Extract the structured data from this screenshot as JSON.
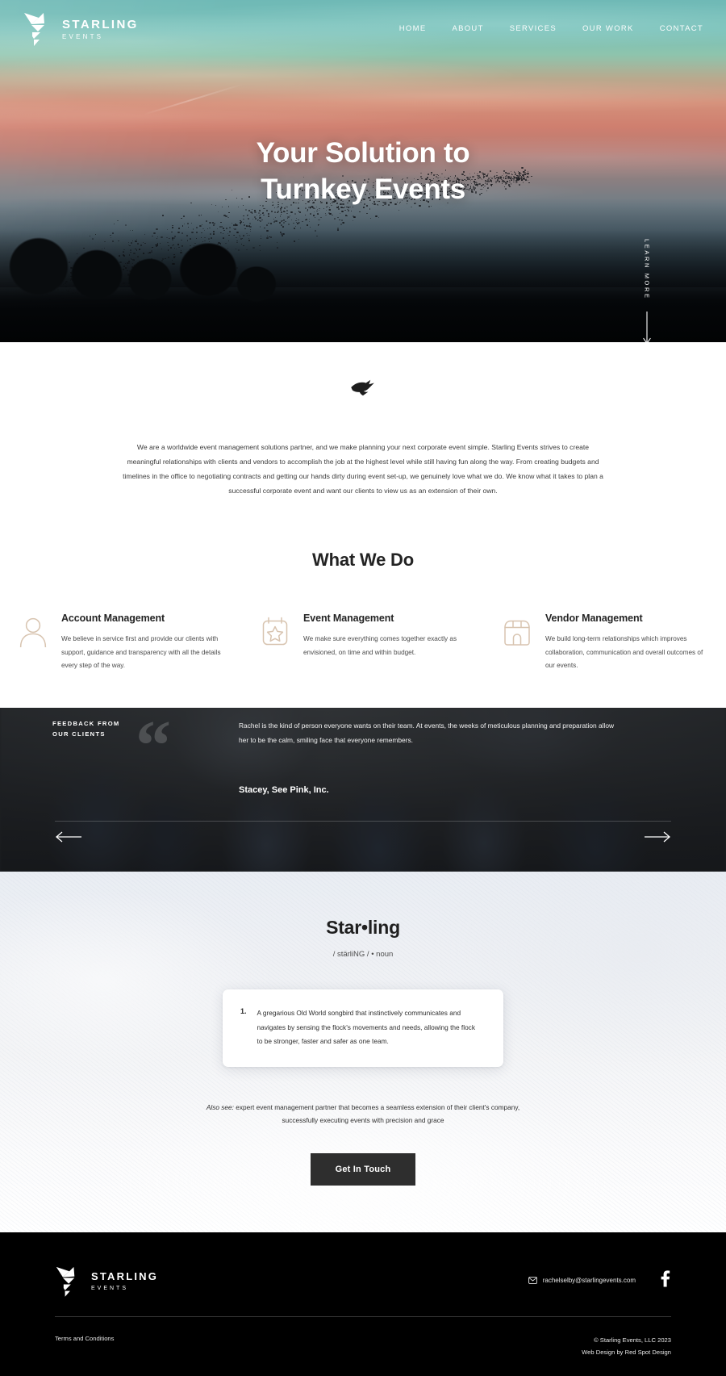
{
  "brand": {
    "name": "STARLING",
    "sub": "EVENTS"
  },
  "nav": {
    "items": [
      {
        "label": "HOME"
      },
      {
        "label": "ABOUT"
      },
      {
        "label": "SERVICES"
      },
      {
        "label": "OUR WORK"
      },
      {
        "label": "CONTACT"
      }
    ]
  },
  "hero": {
    "title_line1": "Your Solution to",
    "title_line2": "Turnkey Events",
    "learn_more": "LEARN MORE"
  },
  "intro": {
    "paragraph": "We are a worldwide event management solutions partner, and we make planning your next corporate event simple. Starling Events strives to create meaningful relationships with clients and vendors to accomplish the job at the highest level while still having fun along the way. From creating budgets and timelines in the office to negotiating contracts and getting our hands dirty during event set-up, we genuinely love what we do. We know what it takes to plan a successful corporate event and want our clients to view us as an extension of their own."
  },
  "what_we_do": {
    "title": "What We Do",
    "cards": [
      {
        "icon": "person-icon",
        "heading": "Account Management",
        "text": "We believe in service first and provide our clients with support, guidance and transparency with all the details every step of the way."
      },
      {
        "icon": "calendar-star-icon",
        "heading": "Event Management",
        "text": "We make sure everything comes together exactly as envisioned, on time and within budget."
      },
      {
        "icon": "storefront-icon",
        "heading": "Vendor Management",
        "text": "We build long-term relationships which improves collaboration, communication and overall outcomes of our events."
      }
    ]
  },
  "testimonial": {
    "label_line1": "FEEDBACK FROM",
    "label_line2": "OUR CLIENTS",
    "quote_mark": "“",
    "quote": "Rachel is the kind of person everyone wants on their team. At events, the weeks of meticulous planning and preparation allow her to be the calm, smiling face that everyone remembers.",
    "author": "Stacey, See Pink, Inc.",
    "prev": "previous-testimonial",
    "next": "next-testimonial"
  },
  "definition": {
    "word": "Star•ling",
    "pronunciation": "/ stärliNG / • noun",
    "entry_number": "1.",
    "entry_text": "A gregarious Old World songbird that instinctively communicates and navigates by sensing the flock's movements and needs, allowing the flock to be stronger, faster and safer as one team.",
    "also_see_label": "Also see:",
    "also_see_text": " expert event management partner that becomes a seamless extension of their client's company, successfully executing events with precision and grace",
    "cta": "Get In Touch"
  },
  "footer": {
    "email": "rachelselby@starlingevents.com",
    "terms": "Terms and Conditions",
    "copyright": "© Starling Events, LLC 2023",
    "credit": "Web Design by Red Spot Design",
    "social": "facebook-icon"
  },
  "colors": {
    "accent_tan": "#d8c4b0",
    "dark": "#2e2e2e",
    "footer_bg": "#000000"
  }
}
